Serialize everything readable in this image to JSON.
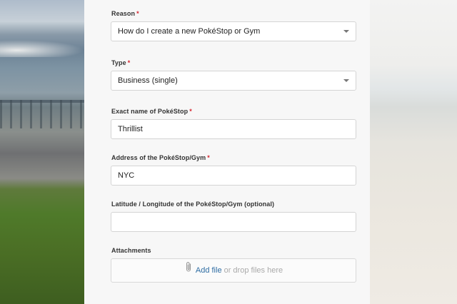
{
  "form": {
    "reason": {
      "label": "Reason",
      "value": "How do I create a new PokéStop or Gym"
    },
    "type": {
      "label": "Type",
      "value": "Business (single)"
    },
    "pokestop_name": {
      "label": "Exact name of PokéStop",
      "value": "Thrillist"
    },
    "address": {
      "label": "Address of the PokéStop/Gym",
      "value": "NYC"
    },
    "latlong": {
      "label": "Latitude / Longitude of the PokéStop/Gym (optional)",
      "value": ""
    },
    "attachments": {
      "label": "Attachments",
      "add_file": "Add file",
      "drop_text": "or drop files here"
    },
    "required_mark": "*"
  },
  "colors": {
    "required": "#d6252f",
    "link": "#2f6da3"
  },
  "icons": {
    "select_caret": "chevron-down-icon",
    "attachment": "paperclip-icon"
  }
}
